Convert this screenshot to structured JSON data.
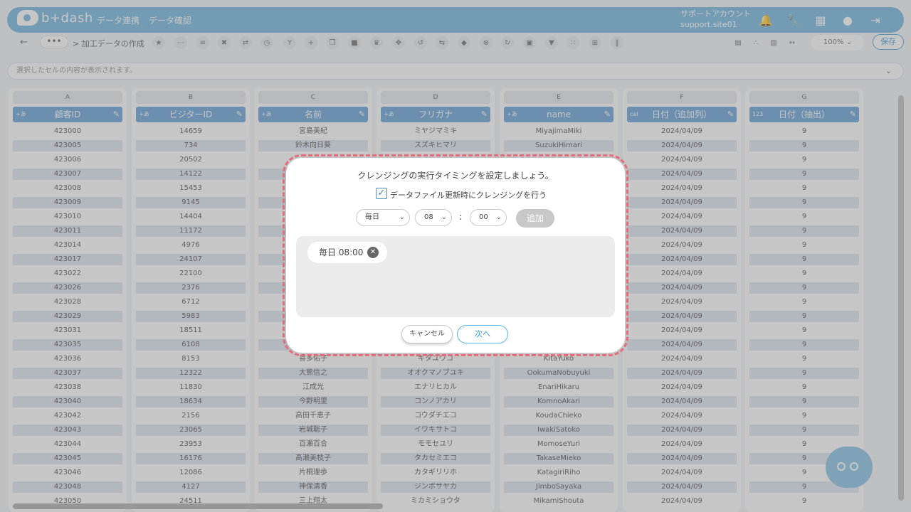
{
  "header": {
    "logo_text": "b+dash",
    "nav": [
      "データ連携",
      "データ確認"
    ],
    "account_line1": "サポートアカウント",
    "account_line2": "support.site01"
  },
  "toolbar": {
    "breadcrumb_more": "•••",
    "breadcrumb": "> 加工データの作成",
    "zoom": "100%",
    "save_label": "保存"
  },
  "message_bar": {
    "placeholder": "選択したセルの内容が表示されます。"
  },
  "grid": {
    "columns": [
      {
        "letter": "A",
        "type": "+あ",
        "name": "顧客ID",
        "rows": [
          "423000",
          "423005",
          "423006",
          "423007",
          "423008",
          "423009",
          "423010",
          "423011",
          "423014",
          "423017",
          "423022",
          "423026",
          "423028",
          "423029",
          "423031",
          "423035",
          "423036",
          "423037",
          "423038",
          "423040",
          "423042",
          "423043",
          "423044",
          "423045",
          "423046",
          "423048",
          "423050"
        ]
      },
      {
        "letter": "B",
        "type": "+あ",
        "name": "ビジターID",
        "rows": [
          "14659",
          "734",
          "20502",
          "14122",
          "15453",
          "9145",
          "14404",
          "11172",
          "4976",
          "24107",
          "22100",
          "2376",
          "6712",
          "5983",
          "18511",
          "6108",
          "8153",
          "12322",
          "11830",
          "18634",
          "2156",
          "23065",
          "23953",
          "16176",
          "12086",
          "4127",
          "24511"
        ]
      },
      {
        "letter": "C",
        "type": "+あ",
        "name": "名前",
        "rows": [
          "宮島美紀",
          "鈴木向日葵",
          "",
          "",
          "",
          "",
          "",
          "",
          "",
          "",
          "",
          "",
          "",
          "",
          "",
          "",
          "喜多佑子",
          "大熊信之",
          "江成光",
          "今野明里",
          "高田千恵子",
          "岩城聡子",
          "百瀬百合",
          "高瀬美枝子",
          "片桐理歩",
          "神保清香",
          "三上翔太"
        ]
      },
      {
        "letter": "D",
        "type": "+あ",
        "name": "フリガナ",
        "rows": [
          "ミヤジマミキ",
          "スズキヒマリ",
          "",
          "",
          "",
          "",
          "",
          "",
          "",
          "",
          "",
          "",
          "",
          "",
          "",
          "",
          "キタユウコ",
          "オオクマノブユキ",
          "エナリヒカル",
          "コンノアカリ",
          "コウダチエコ",
          "イワキサトコ",
          "モモセユリ",
          "タカセミエコ",
          "カタギリリホ",
          "ジンボサヤカ",
          "ミカミショウタ"
        ]
      },
      {
        "letter": "E",
        "type": "+あ",
        "name": "name",
        "rows": [
          "MiyajimaMiki",
          "SuzukiHimari",
          "",
          "",
          "",
          "",
          "",
          "",
          "",
          "",
          "",
          "",
          "",
          "",
          "",
          "",
          "KitaYuko",
          "OokumaNobuyuki",
          "EnariHikaru",
          "KomnoAkari",
          "KoudaChieko",
          "IwakiSatoko",
          "MomoseYuri",
          "TakaseMieko",
          "KatagiriRiho",
          "JimboSayaka",
          "MikamiShouta"
        ]
      },
      {
        "letter": "F",
        "type": "cal",
        "name": "日付（追加列）",
        "rows": [
          "2024/04/09",
          "2024/04/09",
          "2024/04/09",
          "2024/04/09",
          "2024/04/09",
          "2024/04/09",
          "2024/04/09",
          "2024/04/09",
          "2024/04/09",
          "2024/04/09",
          "2024/04/09",
          "2024/04/09",
          "2024/04/09",
          "2024/04/09",
          "2024/04/09",
          "2024/04/09",
          "2024/04/09",
          "2024/04/09",
          "2024/04/09",
          "2024/04/09",
          "2024/04/09",
          "2024/04/09",
          "2024/04/09",
          "2024/04/09",
          "2024/04/09",
          "2024/04/09",
          "2024/04/09"
        ]
      },
      {
        "letter": "G",
        "type": "123",
        "name": "日付（抽出）",
        "rows": [
          "9",
          "9",
          "9",
          "9",
          "9",
          "9",
          "9",
          "9",
          "9",
          "9",
          "9",
          "9",
          "9",
          "9",
          "9",
          "9",
          "9",
          "9",
          "9",
          "9",
          "9",
          "9",
          "9",
          "9",
          "9",
          "9",
          "9"
        ]
      }
    ]
  },
  "dialog": {
    "title": "クレンジングの実行タイミングを設定しましょう。",
    "checkbox_label": "データファイル更新時にクレンジングを行う",
    "checkbox_checked": true,
    "frequency": "毎日",
    "hour": "08",
    "colon": ":",
    "minute": "00",
    "add_label": "追加",
    "schedules": [
      "毎日 08:00"
    ],
    "cancel_label": "キャンセル",
    "next_label": "次へ"
  },
  "colors": {
    "brand": "#69b3df",
    "column_header": "#5b9bd5",
    "highlight_dash": "#e36d7c"
  }
}
